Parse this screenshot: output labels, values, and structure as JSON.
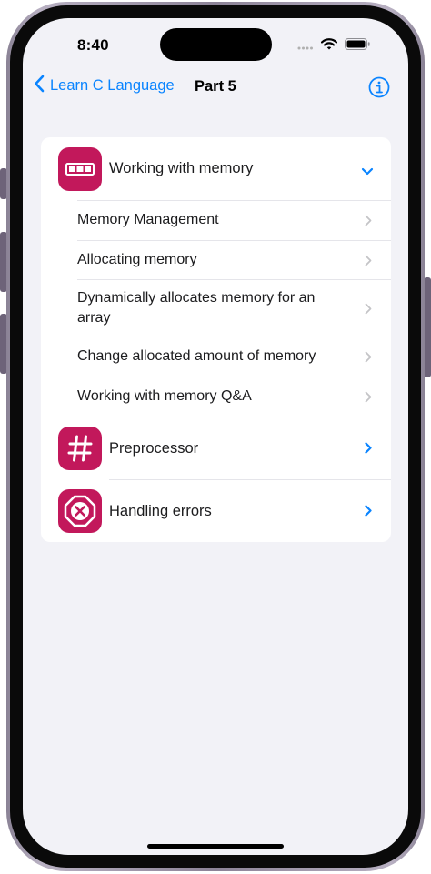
{
  "status_bar": {
    "time": "8:40",
    "signal_icon": "signal-icon",
    "wifi_icon": "wifi-icon",
    "battery_icon": "battery-icon"
  },
  "nav": {
    "back_label": "Learn C Language",
    "title": "Part 5",
    "info_icon": "info-icon"
  },
  "sections": [
    {
      "label": "Working with memory",
      "icon": "memory-icon",
      "expanded": true,
      "items": [
        "Memory Management",
        "Allocating memory",
        "Dynamically allocates memory for an array",
        "Change allocated amount of memory",
        "Working with memory Q&A"
      ]
    },
    {
      "label": "Preprocessor",
      "icon": "hash-icon",
      "expanded": false
    },
    {
      "label": "Handling errors",
      "icon": "error-octagon-icon",
      "expanded": false
    }
  ],
  "colors": {
    "accent": "#0a84ff",
    "icon_bg": "#c2185b",
    "background": "#f2f2f7",
    "card": "#ffffff"
  }
}
